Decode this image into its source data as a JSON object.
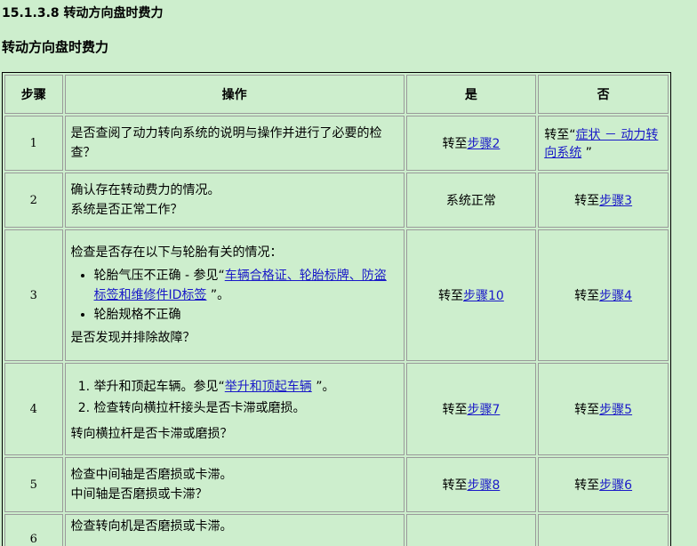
{
  "section_heading": "15.1.3.8 转动方向盘时费力",
  "sub_heading": "转动方向盘时费力",
  "table": {
    "headers": {
      "step": "步骤",
      "op": "操作",
      "yes": "是",
      "no": "否"
    },
    "rows": [
      {
        "step": "1",
        "op_lines": [
          "是否查阅了动力转向系统的说明与操作并进行了必要的检查？"
        ],
        "yes": {
          "prefix": "转至",
          "link": "步骤2",
          "suffix": ""
        },
        "no": {
          "prefix": "转至“",
          "link": "症状 － 动力转向系统",
          "suffix": " ”"
        }
      },
      {
        "step": "2",
        "op_lines": [
          "确认存在转动费力的情况。",
          "系统是否正常工作？"
        ],
        "yes": {
          "prefix": "系统正常",
          "link": "",
          "suffix": ""
        },
        "no": {
          "prefix": "转至",
          "link": "步骤3",
          "suffix": ""
        }
      },
      {
        "step": "3",
        "op_intro": "检查是否存在以下与轮胎有关的情况：",
        "bullets": [
          {
            "prefix": "轮胎气压不正确  - 参见“",
            "link": "车辆合格证、轮胎标牌、防盗标签和维修件ID标签",
            "suffix": " ”。"
          },
          {
            "prefix": "轮胎规格不正确",
            "link": "",
            "suffix": ""
          }
        ],
        "op_question": "是否发现并排除故障？",
        "yes": {
          "prefix": "转至",
          "link": "步骤10",
          "suffix": ""
        },
        "no": {
          "prefix": "转至",
          "link": "步骤4",
          "suffix": ""
        }
      },
      {
        "step": "4",
        "numbered": [
          {
            "prefix": "举升和顶起车辆。参见“",
            "link": "举升和顶起车辆",
            "suffix": " ”。"
          },
          {
            "prefix": "检查转向横拉杆接头是否卡滞或磨损。",
            "link": "",
            "suffix": ""
          }
        ],
        "op_question": "转向横拉杆是否卡滞或磨损？",
        "yes": {
          "prefix": "转至",
          "link": "步骤7",
          "suffix": ""
        },
        "no": {
          "prefix": "转至",
          "link": "步骤5",
          "suffix": ""
        }
      },
      {
        "step": "5",
        "op_lines": [
          "检查中间轴是否磨损或卡滞。",
          "中间轴是否磨损或卡滞？"
        ],
        "yes": {
          "prefix": "转至",
          "link": "步骤8",
          "suffix": ""
        },
        "no": {
          "prefix": "转至",
          "link": "步骤6",
          "suffix": ""
        }
      },
      {
        "step": "6",
        "op_lines": [
          "检查转向机是否磨损或卡滞。"
        ]
      }
    ]
  }
}
